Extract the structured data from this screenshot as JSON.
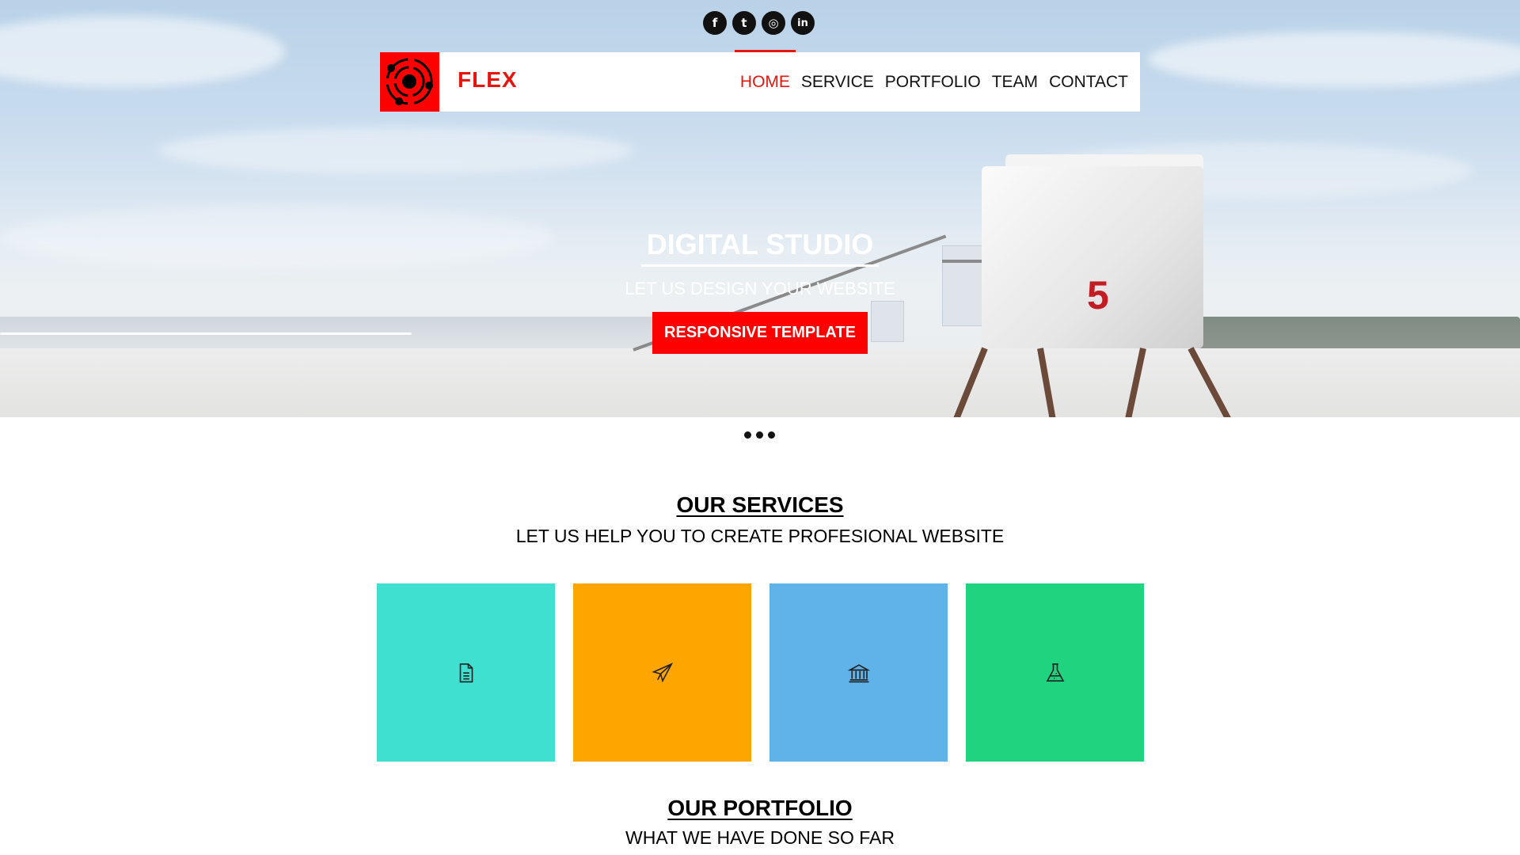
{
  "social": [
    {
      "name": "facebook-icon",
      "glyph": "f"
    },
    {
      "name": "twitter-icon",
      "glyph": "t"
    },
    {
      "name": "instagram-icon",
      "glyph": "◎"
    },
    {
      "name": "linkedin-icon",
      "glyph": "in"
    }
  ],
  "brand": {
    "name": "FLEX",
    "color": "#e8140e"
  },
  "nav": {
    "items": [
      "HOME",
      "SERVICE",
      "PORTFOLIO",
      "TEAM",
      "CONTACT"
    ],
    "active": "HOME"
  },
  "hero": {
    "title": "DIGITAL STUDIO",
    "subtitle": "LET US DESIGN YOUR WEBSITE",
    "button": "RESPONSIVE TEMPLATE",
    "tower_number": "5"
  },
  "services": {
    "title": "OUR SERVICES",
    "subtitle": "LET US HELP YOU TO CREATE PROFESIONAL WEBSITE",
    "tiles": [
      {
        "icon": "document-icon",
        "color": "#40e0d0"
      },
      {
        "icon": "paper-plane-icon",
        "color": "#ffa500"
      },
      {
        "icon": "bank-icon",
        "color": "#5fb3e8"
      },
      {
        "icon": "flask-icon",
        "color": "#1fd37f"
      }
    ]
  },
  "portfolio": {
    "title": "OUR PORTFOLIO",
    "subtitle": "WHAT WE HAVE DONE SO FAR"
  }
}
